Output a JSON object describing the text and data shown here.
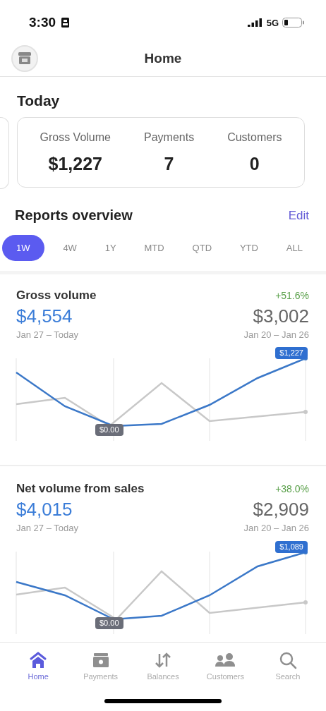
{
  "status_bar": {
    "time": "3:30",
    "network": "5G"
  },
  "header": {
    "title": "Home"
  },
  "today": {
    "title": "Today",
    "stats": [
      {
        "label": "Gross Volume",
        "value": "$1,227"
      },
      {
        "label": "Payments",
        "value": "7"
      },
      {
        "label": "Customers",
        "value": "0"
      }
    ]
  },
  "reports": {
    "title": "Reports overview",
    "edit": "Edit",
    "periods": [
      {
        "label": "1W",
        "selected": true
      },
      {
        "label": "4W",
        "selected": false
      },
      {
        "label": "1Y",
        "selected": false
      },
      {
        "label": "MTD",
        "selected": false
      },
      {
        "label": "QTD",
        "selected": false
      },
      {
        "label": "YTD",
        "selected": false
      },
      {
        "label": "ALL",
        "selected": false
      }
    ],
    "cards": [
      {
        "title": "Gross volume",
        "change": "+51.6%",
        "current": "$4,554",
        "current_range": "Jan 27 – Today",
        "previous": "$3,002",
        "previous_range": "Jan 20 – Jan 26",
        "max_label": "$1,227",
        "min_label": "$0.00"
      },
      {
        "title": "Net volume from sales",
        "change": "+38.0%",
        "current": "$4,015",
        "current_range": "Jan 27 – Today",
        "previous": "$2,909",
        "previous_range": "Jan 20 – Jan 26",
        "max_label": "$1,089",
        "min_label": "$0.00"
      }
    ]
  },
  "tab_bar": [
    {
      "label": "Home",
      "selected": true
    },
    {
      "label": "Payments",
      "selected": false
    },
    {
      "label": "Balances",
      "selected": false
    },
    {
      "label": "Customers",
      "selected": false
    },
    {
      "label": "Search",
      "selected": false
    }
  ]
}
